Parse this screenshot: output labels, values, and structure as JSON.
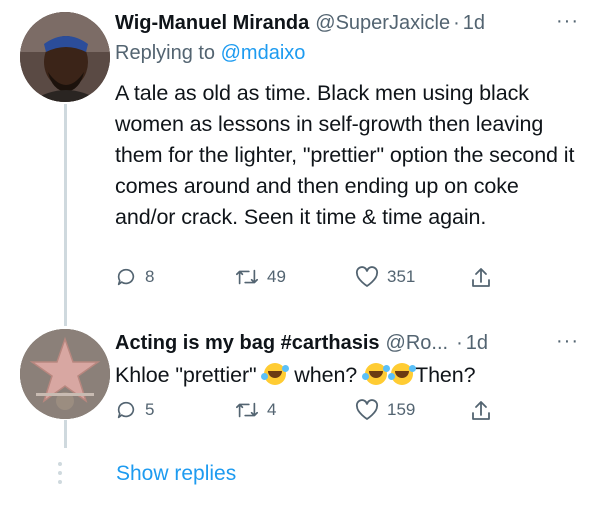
{
  "tweets": [
    {
      "display_name": "Wig-Manuel Miranda",
      "handle": "@SuperJaxicle",
      "time": "1d",
      "replying_prefix": "Replying to",
      "replying_to": "@mdaixo",
      "text": "A tale as old as time. Black men using black women as lessons in self-growth then leaving them for the lighter, \"prettier\" option the second it comes around and then ending up on coke and/or crack. Seen it time & time again.",
      "replies": "8",
      "retweets": "49",
      "likes": "351"
    },
    {
      "display_name": "Acting is my bag #carthasis",
      "handle": "@Ro...",
      "time": "1d",
      "text_parts": [
        "Khloe \"prettier\"",
        "when?",
        "Then?"
      ],
      "replies": "5",
      "retweets": "4",
      "likes": "159"
    }
  ],
  "show_replies_label": "Show replies",
  "icons": {
    "reply": "speech-bubble-icon",
    "retweet": "retweet-arrows-icon",
    "like": "heart-icon",
    "share": "share-upload-icon",
    "more": "more-horizontal-icon",
    "emoji": "rolling-on-floor-laughing-emoji"
  },
  "colors": {
    "link": "#1d9bf0",
    "secondary_text": "#536471",
    "primary_text": "#0f1419",
    "thread_line": "#cfd9de"
  }
}
